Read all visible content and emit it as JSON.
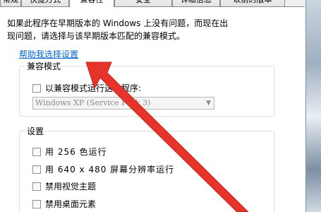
{
  "tabs": [
    {
      "label": "常规",
      "active": false
    },
    {
      "label": "快捷方式",
      "active": false
    },
    {
      "label": "兼容性",
      "active": true
    },
    {
      "label": "安全",
      "active": false
    },
    {
      "label": "详细信息",
      "active": false
    },
    {
      "label": "以前的版本",
      "active": false
    }
  ],
  "description_line1": "如果此程序在早期版本的 Windows 上没有问题，而现在出",
  "description_line2": "现问题，请选择与该早期版本匹配的兼容模式。",
  "help_link": "帮助我选择设置",
  "compat_group": {
    "title": "兼容模式",
    "checkbox_label": "以兼容模式运行这个程序:",
    "os_select_value": "Windows XP (Service Pack 3)"
  },
  "settings_group": {
    "title": "设置",
    "options": [
      "用 256 色运行",
      "用 640 x 480 屏幕分辨率运行",
      "禁用视觉主题",
      "禁用桌面元素"
    ]
  },
  "colors": {
    "link": "#0066cc",
    "annotation_arrow": "#e6342a"
  }
}
